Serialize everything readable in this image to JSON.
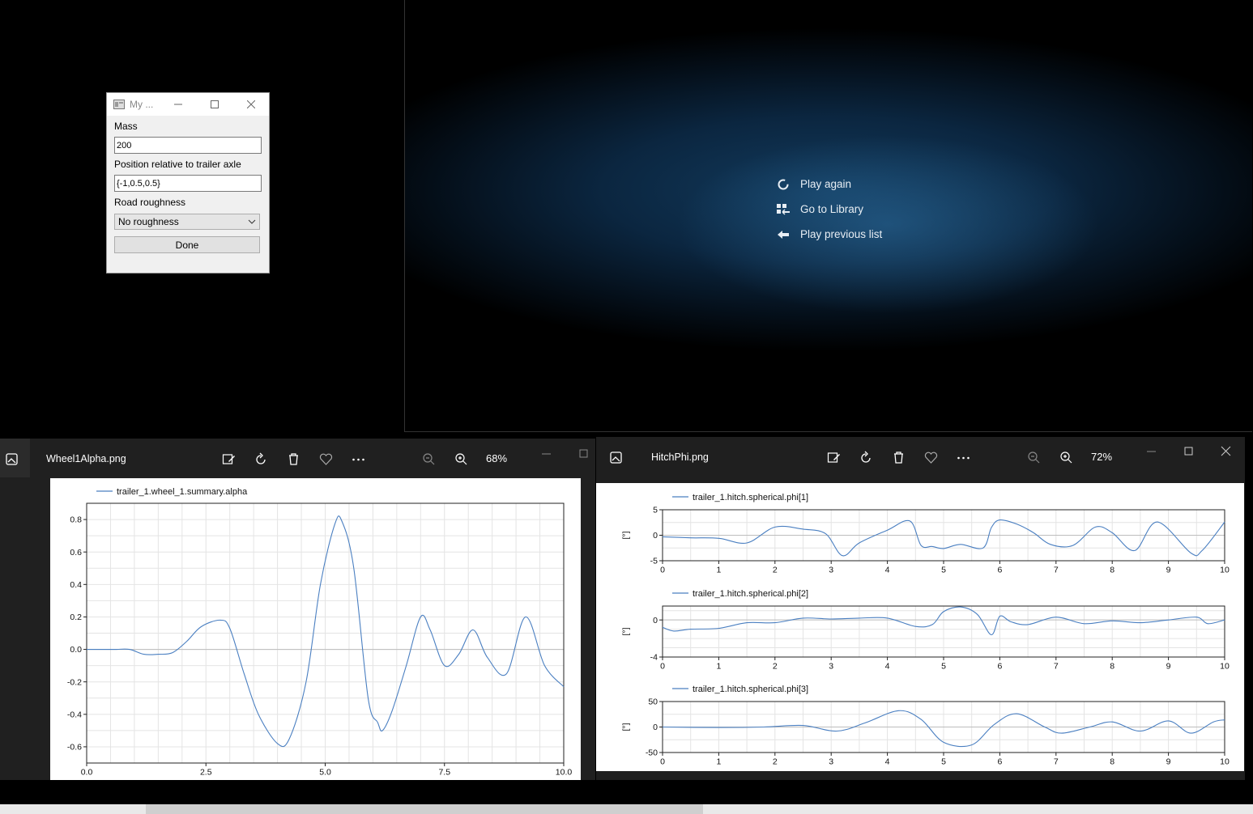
{
  "dialog": {
    "title": "My ...",
    "labels": {
      "mass": "Mass",
      "position": "Position relative to trailer axle",
      "roughness": "Road roughness"
    },
    "mass_value": "200",
    "position_value": "{-1,0.5,0.5}",
    "roughness_selected": "No roughness",
    "done_label": "Done"
  },
  "player": {
    "items": [
      {
        "label": "Play again",
        "icon": "replay-icon"
      },
      {
        "label": "Go to Library",
        "icon": "library-icon"
      },
      {
        "label": "Play previous list",
        "icon": "back-arrow-icon"
      }
    ]
  },
  "viewer1": {
    "filename": "Wheel1Alpha.png",
    "zoom": "68%"
  },
  "viewer2": {
    "filename": "HitchPhi.png",
    "zoom": "72%"
  },
  "chart_data": [
    {
      "type": "line",
      "legend": "trailer_1.wheel_1.summary.alpha",
      "xticks": [
        "0.0",
        "2.5",
        "5.0",
        "7.5",
        "10.0"
      ],
      "yticks": [
        "0.8",
        "0.6",
        "0.4",
        "0.2",
        "0.0",
        "-0.2",
        "-0.4",
        "-0.6"
      ],
      "xlim": [
        0,
        10
      ],
      "ylim": [
        -0.7,
        0.9
      ],
      "x": [
        0,
        0.3,
        0.6,
        0.9,
        1.2,
        1.5,
        1.8,
        2.1,
        2.4,
        2.8,
        3.0,
        3.3,
        3.6,
        4.0,
        4.25,
        4.6,
        4.9,
        5.2,
        5.35,
        5.6,
        5.9,
        6.1,
        6.2,
        6.4,
        6.7,
        7.0,
        7.2,
        7.5,
        7.8,
        8.1,
        8.4,
        8.8,
        9.2,
        9.6,
        10.0
      ],
      "y": [
        0,
        0,
        0,
        0,
        -0.03,
        -0.03,
        -0.02,
        0.05,
        0.14,
        0.18,
        0.13,
        -0.15,
        -0.4,
        -0.58,
        -0.55,
        -0.2,
        0.4,
        0.77,
        0.79,
        0.5,
        -0.3,
        -0.45,
        -0.5,
        -0.38,
        -0.1,
        0.2,
        0.12,
        -0.1,
        -0.03,
        0.12,
        -0.05,
        -0.15,
        0.2,
        -0.1,
        -0.23
      ],
      "grid": true,
      "legend_position": "top-left"
    },
    {
      "type": "line",
      "legend": "trailer_1.hitch.spherical.phi[1]",
      "ylabel": "[°]",
      "xticks": [
        "0",
        "1",
        "2",
        "3",
        "4",
        "5",
        "6",
        "7",
        "8",
        "9",
        "10"
      ],
      "yticks": [
        "5",
        "0",
        "-5"
      ],
      "xlim": [
        0,
        10
      ],
      "ylim": [
        -5,
        5
      ],
      "x": [
        0,
        0.5,
        1.0,
        1.5,
        2.0,
        2.5,
        2.9,
        3.2,
        3.5,
        4.0,
        4.4,
        4.6,
        4.8,
        5.0,
        5.3,
        5.7,
        5.85,
        6.0,
        6.3,
        6.6,
        6.9,
        7.3,
        7.7,
        8.0,
        8.4,
        8.8,
        9.4,
        9.6,
        10.0
      ],
      "y": [
        -0.3,
        -0.5,
        -0.6,
        -1.5,
        1.6,
        1.2,
        0.3,
        -4.0,
        -1.5,
        1.0,
        2.8,
        -2.0,
        -2.2,
        -2.6,
        -1.8,
        -2.5,
        1.5,
        3.0,
        2.2,
        0.5,
        -1.8,
        -2.0,
        1.6,
        0.5,
        -3.0,
        2.6,
        -3.5,
        -3.0,
        2.6
      ],
      "grid": true,
      "legend_position": "top-left"
    },
    {
      "type": "line",
      "legend": "trailer_1.hitch.spherical.phi[2]",
      "ylabel": "[°]",
      "xticks": [
        "0",
        "1",
        "2",
        "3",
        "4",
        "5",
        "6",
        "7",
        "8",
        "9",
        "10"
      ],
      "yticks": [
        "0",
        "-4"
      ],
      "xlim": [
        0,
        10
      ],
      "ylim": [
        -4,
        1.5
      ],
      "x": [
        0,
        0.2,
        0.5,
        1.0,
        1.5,
        2.0,
        2.5,
        3.0,
        3.5,
        4.0,
        4.5,
        4.8,
        5.0,
        5.3,
        5.6,
        5.85,
        6.0,
        6.2,
        6.5,
        7.0,
        7.5,
        8.0,
        8.5,
        9.0,
        9.5,
        9.7,
        10.0
      ],
      "y": [
        -0.8,
        -1.2,
        -1.0,
        -0.9,
        -0.3,
        -0.3,
        0.2,
        0.1,
        0.2,
        0.2,
        -0.7,
        -0.5,
        0.9,
        1.4,
        0.6,
        -1.6,
        0.4,
        -0.2,
        -0.5,
        0.3,
        -0.4,
        -0.1,
        -0.3,
        0.0,
        0.3,
        -0.4,
        0.0
      ],
      "grid": true,
      "legend_position": "top-left"
    },
    {
      "type": "line",
      "legend": "trailer_1.hitch.spherical.phi[3]",
      "ylabel": "[°]",
      "xticks": [
        "0",
        "1",
        "2",
        "3",
        "4",
        "5",
        "6",
        "7",
        "8",
        "9",
        "10"
      ],
      "yticks": [
        "50",
        "0",
        "-50"
      ],
      "xlim": [
        0,
        10
      ],
      "ylim": [
        -50,
        50
      ],
      "x": [
        0,
        1.0,
        1.8,
        2.5,
        3.1,
        3.6,
        4.2,
        4.6,
        5.0,
        5.5,
        5.9,
        6.3,
        6.8,
        7.1,
        7.6,
        8.0,
        8.5,
        9.0,
        9.4,
        9.8,
        10.0
      ],
      "y": [
        0,
        -1,
        0,
        3,
        -8,
        8,
        32,
        15,
        -30,
        -35,
        5,
        26,
        0,
        -12,
        0,
        10,
        -8,
        12,
        -12,
        10,
        14
      ],
      "grid": true,
      "legend_position": "top-left"
    }
  ]
}
